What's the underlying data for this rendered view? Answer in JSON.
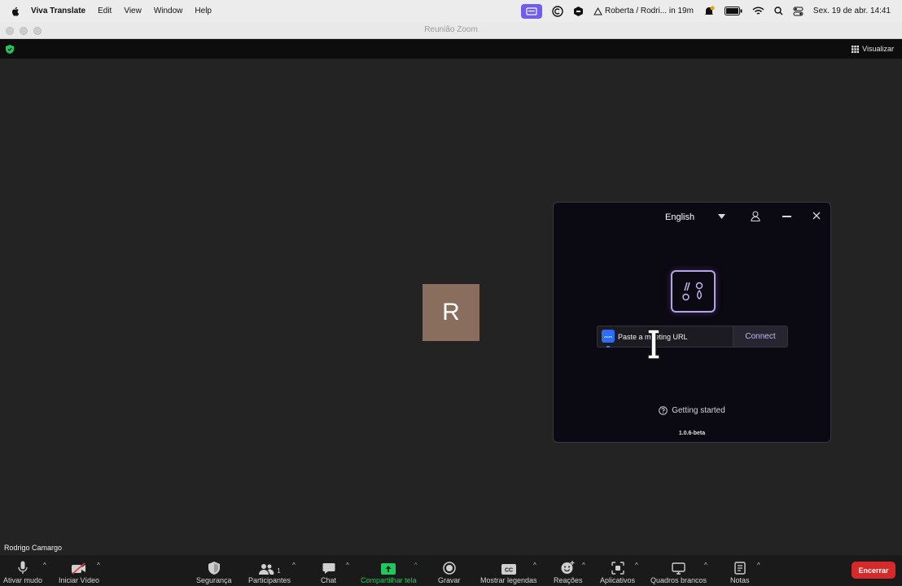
{
  "menubar": {
    "app_name": "Viva Translate",
    "menus": [
      "Edit",
      "View",
      "Window",
      "Help"
    ],
    "calendar_event": "Roberta / Rodri... in 19m",
    "datetime": "Sex. 19 de abr.  14:41"
  },
  "window": {
    "title": "Reunião Zoom"
  },
  "zoom_header": {
    "view_label": "Visualizar"
  },
  "meeting": {
    "avatar_letter": "R",
    "participant_name": "Rodrigo Camargo"
  },
  "viva": {
    "language": "English",
    "zoom_badge": "zoom",
    "url_placeholder": "Paste a meeting URL",
    "connect_label": "Connect",
    "help_label": "Getting started",
    "version": "1.0.6-beta"
  },
  "toolbar": {
    "mute_label": "Ativar mudo",
    "video_label": "Iniciar Vídeo",
    "security_label": "Segurança",
    "participants_label": "Participantes",
    "participants_count": "1",
    "chat_label": "Chat",
    "share_label": "Compartilhar tela",
    "record_label": "Gravar",
    "captions_label": "Mostrar legendas",
    "reactions_label": "Reações",
    "apps_label": "Aplicativos",
    "whiteboard_label": "Quadros brancos",
    "notes_label": "Notas",
    "end_label": "Encerrar"
  },
  "colors": {
    "accent_purple": "#6f5cf0",
    "share_green": "#22c55e",
    "end_red": "#d62a2a",
    "avatar_bg": "#8a6e5d"
  }
}
